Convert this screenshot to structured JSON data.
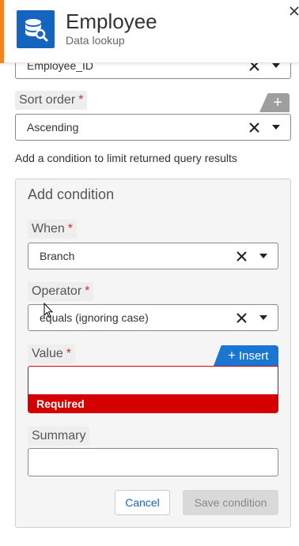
{
  "header": {
    "title": "Employee",
    "subtitle": "Data lookup",
    "icon": "database-search-icon",
    "accent_color": "#f58220",
    "icon_bg_color": "#1565c0"
  },
  "top_field": {
    "value": "Employee_ID"
  },
  "sort_order": {
    "label": "Sort order",
    "required_mark": "*",
    "value": "Ascending",
    "add_label": "+"
  },
  "helper_text": "Add a condition to limit returned query results",
  "add_condition": {
    "title": "Add condition",
    "when": {
      "label": "When",
      "required_mark": "*",
      "value": "Branch"
    },
    "operator": {
      "label": "Operator",
      "required_mark": "*",
      "value": "equals (ignoring case)"
    },
    "value_field": {
      "label": "Value",
      "required_mark": "*",
      "insert_plus": "+",
      "insert_label": "Insert",
      "input_value": "",
      "error_text": "Required",
      "error_color": "#d50000"
    },
    "summary": {
      "label": "Summary",
      "input_value": ""
    },
    "cancel_label": "Cancel",
    "save_label": "Save condition"
  }
}
